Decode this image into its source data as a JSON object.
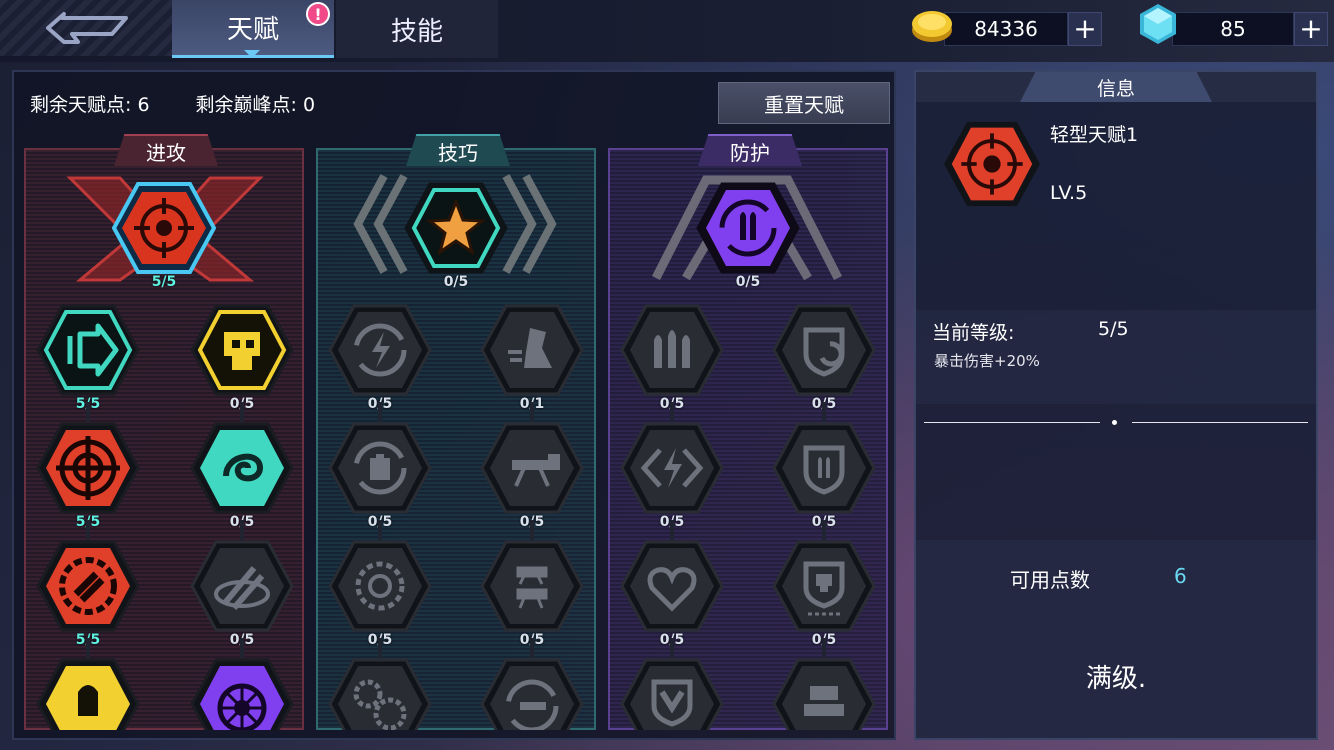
{
  "tabs": {
    "talent": "天赋",
    "skill": "技能",
    "alert": "!"
  },
  "currency": {
    "coins": "84336",
    "gems": "85",
    "plus": "+"
  },
  "points": {
    "talent_label": "剩余天赋点: 6",
    "peak_label": "剩余巅峰点: 0",
    "reset_button": "重置天赋"
  },
  "columns": {
    "attack": {
      "title": "进攻",
      "top_level": "5/5",
      "levels": [
        "5/5",
        "0/5",
        "5/5",
        "0/5",
        "5/5",
        "0/5"
      ]
    },
    "skill": {
      "title": "技巧",
      "top_level": "0/5",
      "levels": [
        "0/5",
        "0/1",
        "0/5",
        "0/5",
        "0/5",
        "0/5"
      ]
    },
    "defense": {
      "title": "防护",
      "top_level": "0/5",
      "levels": [
        "0/5",
        "0/5",
        "0/5",
        "0/5",
        "0/5",
        "0/5"
      ]
    }
  },
  "info": {
    "title": "信息",
    "name": "轻型天赋1",
    "level": "LV.5",
    "current_label": "当前等级:",
    "current_value": "5/5",
    "effect": "暴击伤害+20%",
    "available_label": "可用点数",
    "available_value": "6",
    "max_text": "满级."
  },
  "colors": {
    "attack": "#e0402a",
    "skill": "#40d8c0",
    "defense": "#8040f0",
    "gold": "#f2c930",
    "locked": "#2a2c34"
  }
}
